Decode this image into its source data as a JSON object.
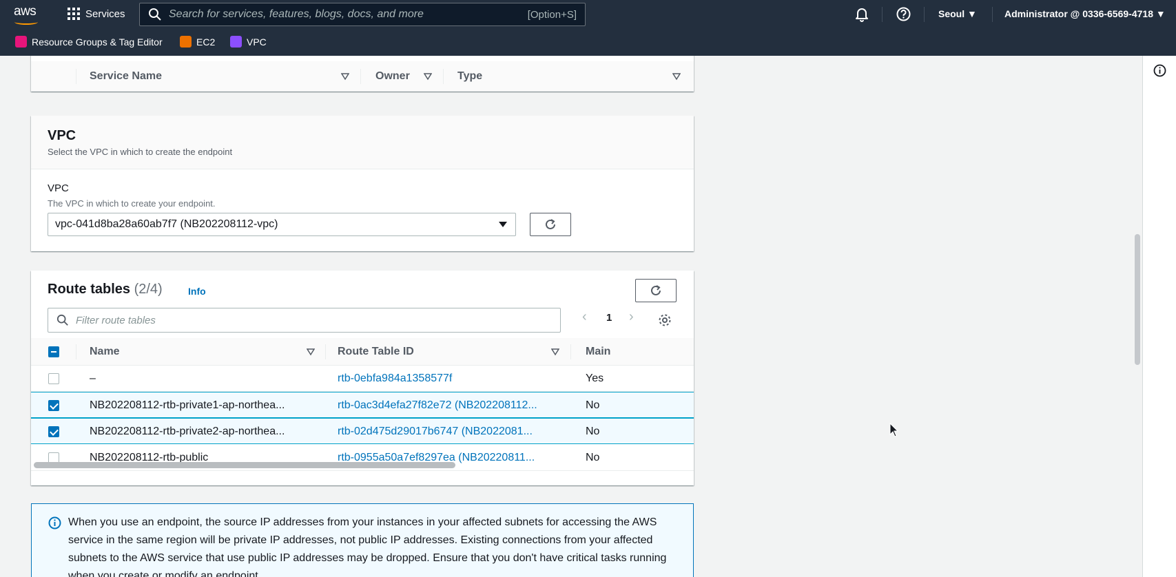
{
  "nav": {
    "logo": "aws",
    "services_label": "Services",
    "search_placeholder": "Search for services, features, blogs, docs, and more",
    "search_shortcut": "[Option+S]",
    "region": "Seoul",
    "account": "Administrator @ 0336-6569-4718"
  },
  "favorites": [
    {
      "label": "Resource Groups & Tag Editor",
      "color": "#e7157b"
    },
    {
      "label": "EC2",
      "color": "#ed7100"
    },
    {
      "label": "VPC",
      "color": "#8c4fff"
    }
  ],
  "services_table": {
    "columns": [
      "Service Name",
      "Owner",
      "Type"
    ]
  },
  "vpc_section": {
    "title": "VPC",
    "description": "Select the VPC in which to create the endpoint",
    "field_label": "VPC",
    "field_description": "The VPC in which to create your endpoint.",
    "selected_value": "vpc-041d8ba28a60ab7f7 (NB202208112-vpc)"
  },
  "route_tables": {
    "title": "Route tables",
    "count": "(2/4)",
    "info_link": "Info",
    "filter_placeholder": "Filter route tables",
    "page": "1",
    "columns": [
      "Name",
      "Route Table ID",
      "Main"
    ],
    "rows": [
      {
        "name": "–",
        "id": "rtb-0ebfa984a1358577f",
        "main": "Yes",
        "checked": false
      },
      {
        "name": "NB202208112-rtb-private1-ap-northea...",
        "id": "rtb-0ac3d4efa27f82e72 (NB202208112...",
        "main": "No",
        "checked": true
      },
      {
        "name": "NB202208112-rtb-private2-ap-northea...",
        "id": "rtb-02d475d29017b6747 (NB2022081...",
        "main": "No",
        "checked": true
      },
      {
        "name": "NB202208112-rtb-public",
        "id": "rtb-0955a50a7ef8297ea (NB20220811...",
        "main": "No",
        "checked": false
      }
    ]
  },
  "alert": {
    "text": "When you use an endpoint, the source IP addresses from your instances in your affected subnets for accessing the AWS service in the same region will be private IP addresses, not public IP addresses. Existing connections from your affected subnets to the AWS service that use public IP addresses may be dropped. Ensure that you don't have critical tasks running when you create or modify an endpoint."
  }
}
